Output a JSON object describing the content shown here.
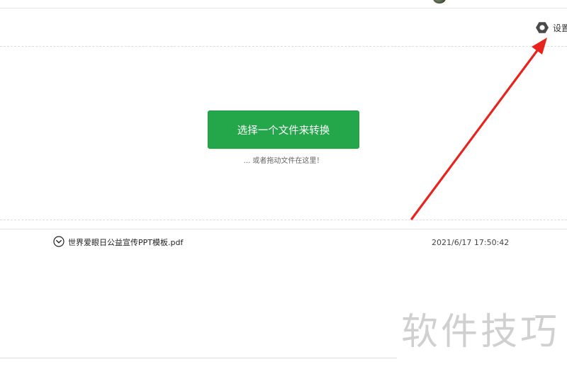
{
  "settings": {
    "label": "设置",
    "icon": "gear-icon"
  },
  "dropzone": {
    "button_label": "选择一个文件来转换",
    "hint": "... 或者拖动文件在这里！"
  },
  "files": [
    {
      "name": "世界爱眼日公益宣传PPT模板.pdf",
      "time": "2021/6/17 17:50:42",
      "icon": "chevron-down-circle-icon"
    }
  ],
  "watermark": "软件技巧",
  "colors": {
    "accent_green": "#23a74a",
    "annotation_red": "#e8231b"
  }
}
